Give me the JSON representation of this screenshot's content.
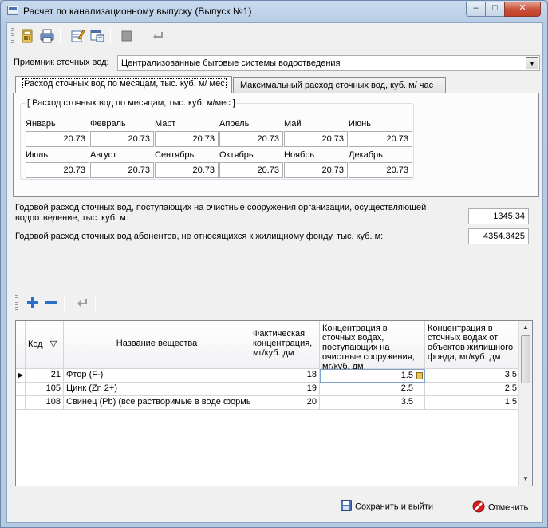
{
  "window": {
    "title": "Расчет по канализационному выпуску (Выпуск №1)",
    "minimize": "–",
    "maximize": "□",
    "close": "✕"
  },
  "receiver": {
    "label": "Приемник сточных вод:",
    "value": "Централизованные бытовые системы водоотведения"
  },
  "tabs": [
    {
      "label": "Расход сточных вод по месяцам, тыс. куб. м/ мес"
    },
    {
      "label": "Максимальный расход сточных вод, куб. м/ час"
    }
  ],
  "monthly": {
    "group_title": "[ Расход сточных вод по месяцам, тыс. куб. м/мес ]",
    "months": [
      {
        "name": "Январь",
        "value": "20.73"
      },
      {
        "name": "Февраль",
        "value": "20.73"
      },
      {
        "name": "Март",
        "value": "20.73"
      },
      {
        "name": "Апрель",
        "value": "20.73"
      },
      {
        "name": "Май",
        "value": "20.73"
      },
      {
        "name": "Июнь",
        "value": "20.73"
      },
      {
        "name": "Июль",
        "value": "20.73"
      },
      {
        "name": "Август",
        "value": "20.73"
      },
      {
        "name": "Сентябрь",
        "value": "20.73"
      },
      {
        "name": "Октябрь",
        "value": "20.73"
      },
      {
        "name": "Ноябрь",
        "value": "20.73"
      },
      {
        "name": "Декабрь",
        "value": "20.73"
      }
    ]
  },
  "annual": {
    "label1": "Годовой расход сточных вод, поступающих на очистные сооружения организации, осуществляющей водоотведение, тыс. куб. м:",
    "value1": "1345.34",
    "label2": "Годовой расход сточных вод абонентов, не относящихся к жилищному фонду, тыс. куб. м:",
    "value2": "4354.3425"
  },
  "grid": {
    "columns": [
      "Код",
      "Название вещества",
      "Фактическая концентрация, мг/куб. дм",
      "Концентрация в сточных водах, поступающих на очистные сооружения, мг/куб. дм",
      "Концентрация в сточных водах от объектов жилищного фонда, мг/куб. дм"
    ],
    "sort_indicator": "▽",
    "rows": [
      {
        "code": "21",
        "name": "Фтор (F-)",
        "fact": "18",
        "conc_plant": "1.5",
        "conc_housing": "3.5"
      },
      {
        "code": "105",
        "name": "Цинк (Zn 2+)",
        "fact": "19",
        "conc_plant": "2.5",
        "conc_housing": "2.5"
      },
      {
        "code": "108",
        "name": "Свинец (Pb) (все растворимые в воде формы)",
        "fact": "20",
        "conc_plant": "3.5",
        "conc_housing": "1.5"
      }
    ],
    "current_row_marker": "▶"
  },
  "footer": {
    "save_label": "Сохранить и выйти",
    "cancel_label": "Отменить"
  },
  "colors": {
    "title_bar": "#b6cbe4",
    "accent_blue": "#2a6fc9",
    "cancel_red": "#d22020"
  }
}
